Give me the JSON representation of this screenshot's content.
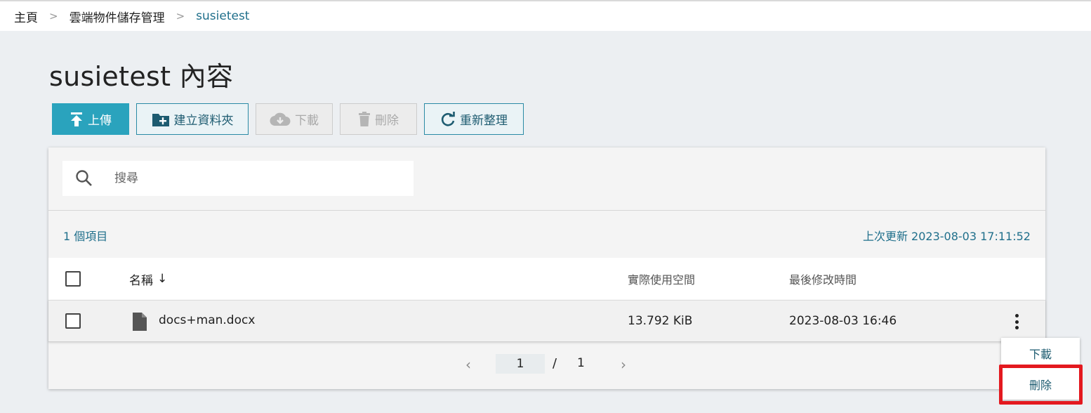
{
  "breadcrumb": {
    "items": [
      "主頁",
      "雲端物件儲存管理",
      "susietest"
    ],
    "separator": ">"
  },
  "page": {
    "title": "susietest 內容"
  },
  "toolbar": {
    "upload": "上傳",
    "new_folder": "建立資料夾",
    "download": "下載",
    "delete": "刪除",
    "refresh": "重新整理"
  },
  "search": {
    "placeholder": "搜尋",
    "value": ""
  },
  "summary": {
    "count": "1 個項目",
    "last_updated": "上次更新 2023-08-03 17:11:52"
  },
  "table": {
    "columns": {
      "name": "名稱",
      "size": "實際使用空間",
      "modified": "最後修改時間"
    },
    "sort_indicator": "↓",
    "rows": [
      {
        "name": "docs+man.docx",
        "size": "13.792 KiB",
        "modified": "2023-08-03 16:46",
        "icon": "file-icon"
      }
    ]
  },
  "pagination": {
    "current": "1",
    "separator": "/",
    "total": "1",
    "prev": "‹",
    "next": "›"
  },
  "context_menu": {
    "items": [
      "下載",
      "刪除"
    ]
  },
  "colors": {
    "accent": "#2aa3bd",
    "link": "#1f6f8b",
    "highlight": "#e3191f",
    "background": "#eceff2"
  }
}
